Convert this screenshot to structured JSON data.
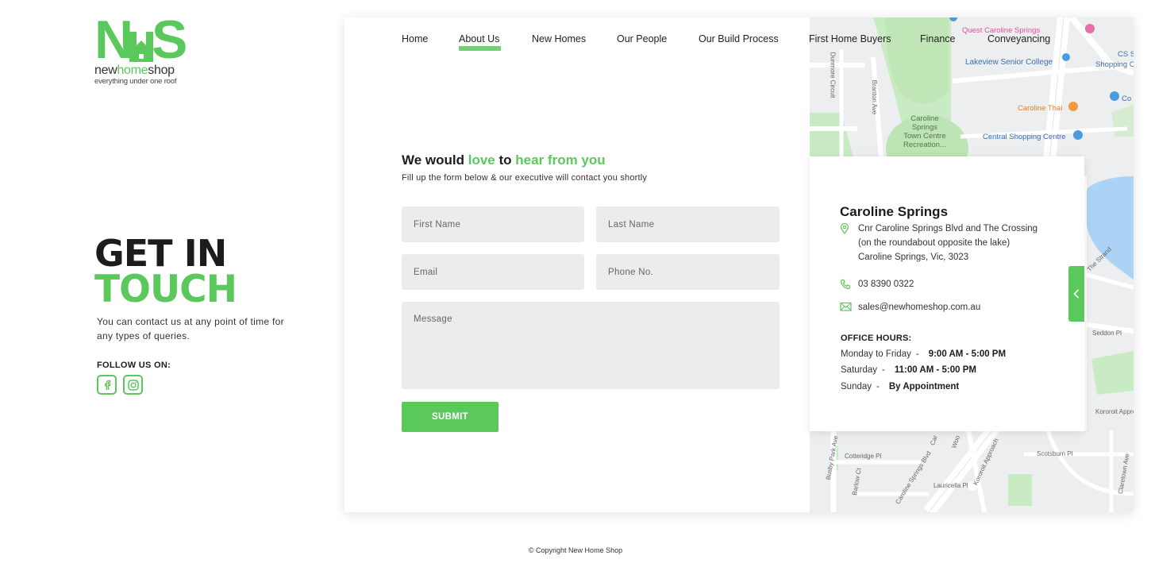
{
  "brand": {
    "mark": [
      "N",
      "S"
    ],
    "word": [
      "new",
      "home",
      "shop"
    ],
    "tagline": "everything under one roof",
    "accent": "#5bc85b"
  },
  "hero": {
    "line1": "GET IN",
    "line2": "TOUCH",
    "description": "You can contact us at any point of time for any types of queries.",
    "follow_label": "FOLLOW US ON:",
    "socials": [
      "facebook-icon",
      "instagram-icon"
    ]
  },
  "nav": {
    "items": [
      {
        "label": "Home"
      },
      {
        "label": "About Us",
        "active": true
      },
      {
        "label": "New Homes"
      },
      {
        "label": "Our People"
      },
      {
        "label": "Our Build Process"
      },
      {
        "label": "First Home Buyers"
      },
      {
        "label": "Finance"
      },
      {
        "label": "Conveyancing"
      }
    ]
  },
  "form": {
    "title_parts": [
      "We would ",
      "love",
      " to ",
      "hear from you"
    ],
    "subtitle": "Fill up the form below & our executive will contact you shortly",
    "first_name_placeholder": "First Name",
    "last_name_placeholder": "Last Name",
    "email_placeholder": "Email",
    "phone_placeholder": "Phone No.",
    "message_placeholder": "Message",
    "submit_label": "SUBMIT"
  },
  "contact": {
    "location": "Caroline Springs",
    "address_lines": [
      "Cnr Caroline Springs Blvd and The Crossing",
      "(on the roundabout opposite the lake)",
      "Caroline Springs, Vic, 3023"
    ],
    "phone": "03 8390 0322",
    "email": "sales@newhomeshop.com.au",
    "hours_label": "OFFICE HOURS:",
    "hours": [
      {
        "days": "Monday to Friday",
        "time": "9:00 AM - 5:00 PM"
      },
      {
        "days": "Saturday",
        "time": "11:00 AM - 5:00 PM"
      },
      {
        "days": "Sunday",
        "time": "By Appointment"
      }
    ]
  },
  "map": {
    "labels": {
      "quest": "Quest Caroline Springs",
      "lakeview": "Lakeview Senior College",
      "cs": "CS S",
      "shopping": "Shopping C",
      "co": "Co",
      "thai": "Caroline Thai",
      "recreation": [
        "Caroline",
        "Springs",
        "Town Centre",
        "Recreation..."
      ],
      "central": "Central Shopping Centre",
      "strand": "The Strand",
      "seddon": "Seddon Pl",
      "kororoit": "Kororoit Approach",
      "kororoit2": "Kororoit Approa",
      "dunmore": "Dunmore Circuit",
      "branton": "Branton Ave",
      "busby": "Busby Park Ave",
      "cotteridge": "Cotteridge Pl",
      "barlow": "Barlow Ct",
      "lauricella": "Lauricella Pl",
      "blvd": "Caroline Springs Blvd",
      "scotsburn": "Scotsburn Pl",
      "claretown": "Claretown Ave",
      "car": "Car",
      "woo": "Woo"
    }
  },
  "footer": {
    "copyright": "© Copyright New Home Shop"
  }
}
